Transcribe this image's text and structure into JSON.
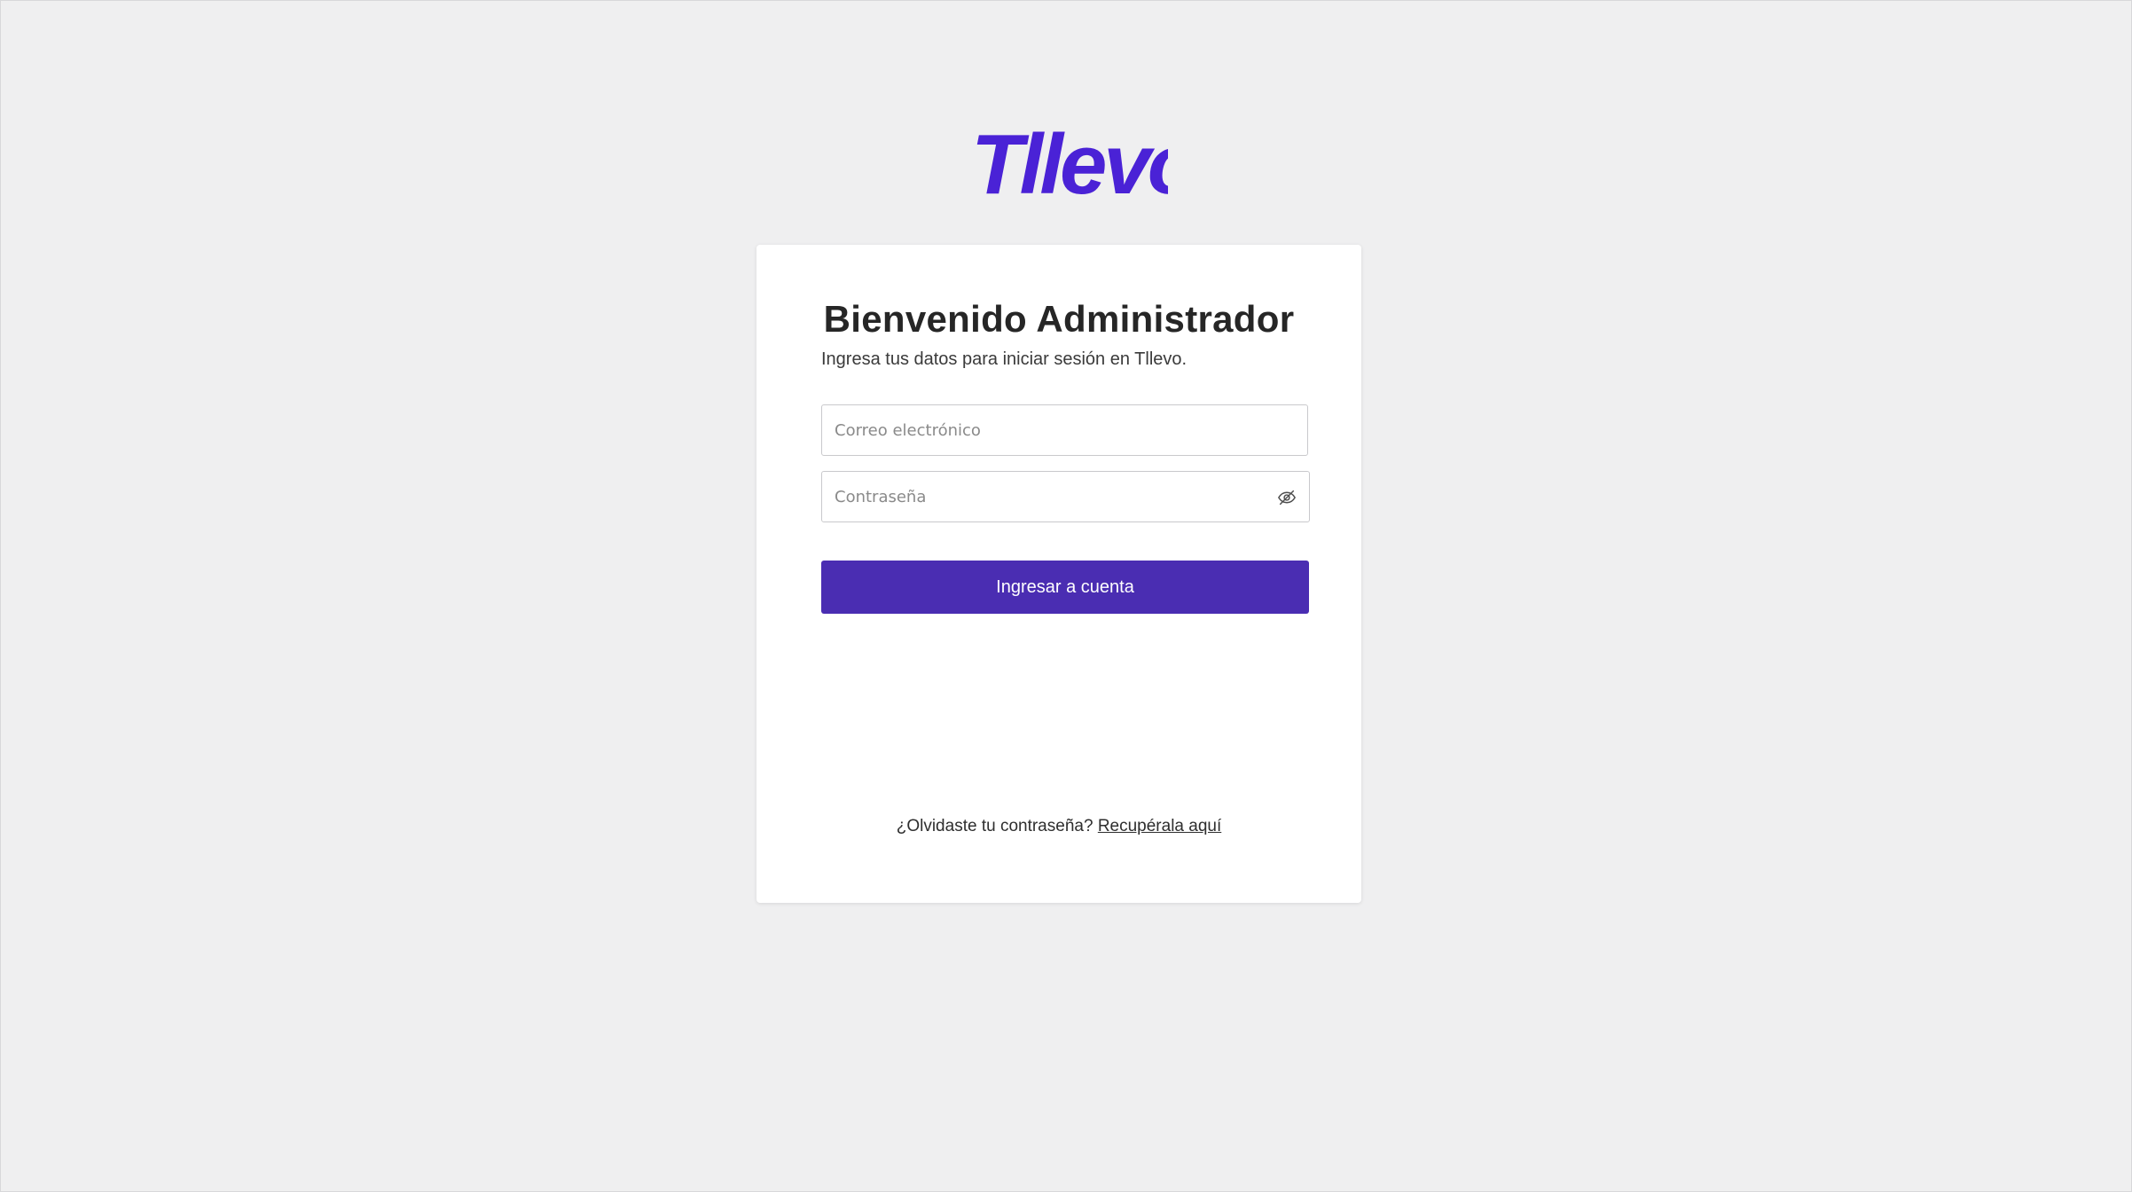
{
  "brand": {
    "logo_text": "Tllevo",
    "accent_color": "#4a2db2",
    "logo_color": "#4a22d6"
  },
  "login": {
    "title": "Bienvenido Administrador",
    "subtitle": "Ingresa tus datos para iniciar sesión en Tllevo.",
    "email": {
      "placeholder": "Correo electrónico",
      "value": ""
    },
    "password": {
      "placeholder": "Contraseña",
      "value": "",
      "toggle_icon": "eye-slash-icon"
    },
    "submit_label": "Ingresar a cuenta",
    "forgot_text": "¿Olvidaste tu contraseña?",
    "forgot_link": "Recupérala aquí"
  }
}
